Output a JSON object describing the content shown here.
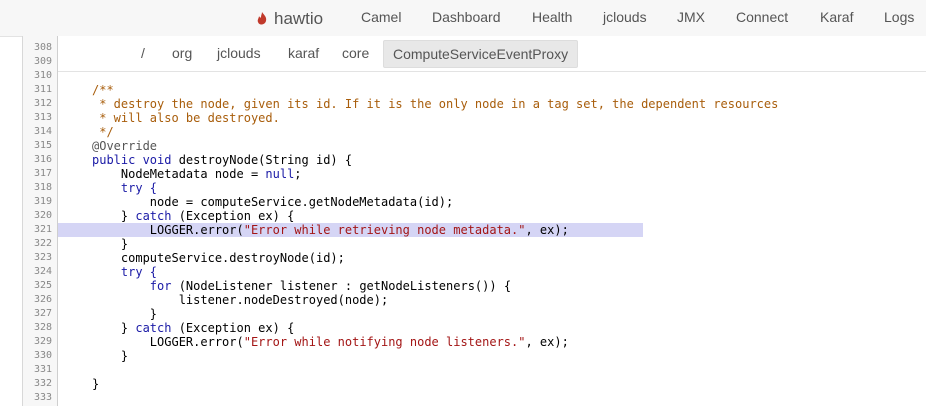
{
  "brand": {
    "name": "hawtio",
    "accent": "#c0392b"
  },
  "nav": [
    "Camel",
    "Dashboard",
    "Health",
    "jclouds",
    "JMX",
    "Connect",
    "Karaf",
    "Logs"
  ],
  "breadcrumb": [
    "/",
    "org",
    "jclouds",
    "karaf",
    "core",
    "ComputeServiceEventProxy"
  ],
  "line_numbers": [
    "308",
    "309",
    "310",
    "311",
    "312",
    "313",
    "314",
    "315",
    "316",
    "317",
    "318",
    "319",
    "320",
    "321",
    "322",
    "323",
    "324",
    "325",
    "326",
    "327",
    "328",
    "329",
    "330",
    "331",
    "332",
    "333"
  ],
  "highlighted_line": "321",
  "code": {
    "l311": "/**",
    "l312": " * destroy the node, given its id. If it is the only node in a tag set, the dependent resources",
    "l313": " * will also be destroyed.",
    "l314": " */",
    "l315": "@Override",
    "l316a": "public void",
    "l316b": " destroyNode(String id) {",
    "l317a": "    NodeMetadata node = ",
    "l317b": "null",
    "l317c": ";",
    "l318": "    try {",
    "l319": "        node = computeService.getNodeMetadata(id);",
    "l320a": "    } ",
    "l320b": "catch",
    "l320c": " (Exception ex) {",
    "l321a": "        LOGGER.error(",
    "l321b": "\"Error while retrieving node metadata.\"",
    "l321c": ", ex);",
    "l322": "    }",
    "l323": "    computeService.destroyNode(id);",
    "l324": "    try {",
    "l325a": "        for",
    "l325b": " (NodeListener listener : getNodeListeners()) {",
    "l326": "            listener.nodeDestroyed(node);",
    "l327": "        }",
    "l328a": "    } ",
    "l328b": "catch",
    "l328c": " (Exception ex) {",
    "l329a": "        LOGGER.error(",
    "l329b": "\"Error while notifying node listeners.\"",
    "l329c": ", ex);",
    "l330": "    }",
    "l331": "",
    "l332": "}",
    "l333": ""
  }
}
